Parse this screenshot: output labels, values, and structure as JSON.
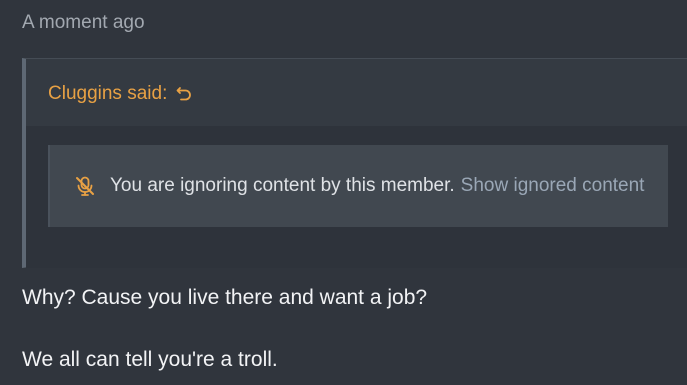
{
  "post": {
    "timestamp": "A moment ago",
    "quote": {
      "author_label": "Cluggins said:",
      "ignored_message": "You are ignoring content by this member.",
      "show_link": "Show ignored content",
      "icons": {
        "reply": "reply-arrow-icon",
        "mute": "microphone-slash-icon"
      }
    },
    "body_lines": [
      "Why? Cause you live there and want a job?",
      "We all can tell you're a troll."
    ]
  },
  "colors": {
    "background": "#30353d",
    "quote_author": "#e8a144",
    "link": "#9aa7b6",
    "ignored_box": "#414850"
  }
}
